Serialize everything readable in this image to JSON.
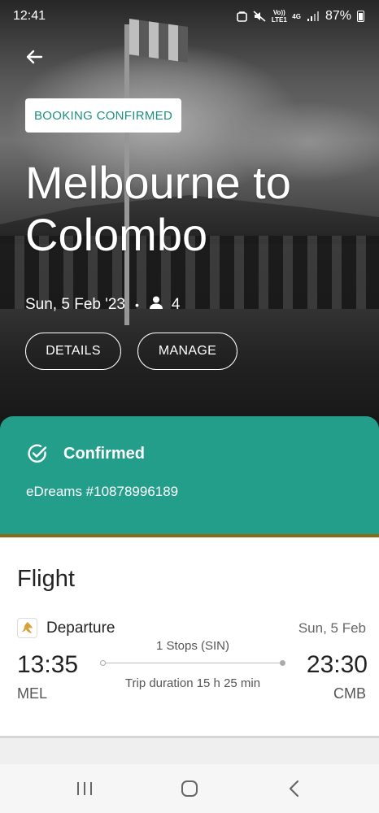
{
  "status_bar": {
    "time": "12:41",
    "network_volte": "Vo)) LTE1",
    "network_type": "4G",
    "battery": "87%"
  },
  "header": {
    "badge": "BOOKING CONFIRMED",
    "title": "Melbourne to Colombo",
    "date": "Sun, 5 Feb '23",
    "separator": "•",
    "passengers": "4",
    "details_button": "DETAILS",
    "manage_button": "MANAGE"
  },
  "confirmation": {
    "status": "Confirmed",
    "booking_ref": "eDreams #10878996189",
    "color": "#239e8a"
  },
  "flight": {
    "section_title": "Flight",
    "leg_label": "Departure",
    "date": "Sun, 5 Feb",
    "departure_time": "13:35",
    "departure_code": "MEL",
    "arrival_time": "23:30",
    "arrival_code": "CMB",
    "stops": "1 Stops (SIN)",
    "duration": "Trip duration 15 h 25 min"
  },
  "nav_bar": {
    "recent_icon": "recent-apps-icon",
    "home_icon": "home-icon",
    "back_icon": "back-icon"
  }
}
